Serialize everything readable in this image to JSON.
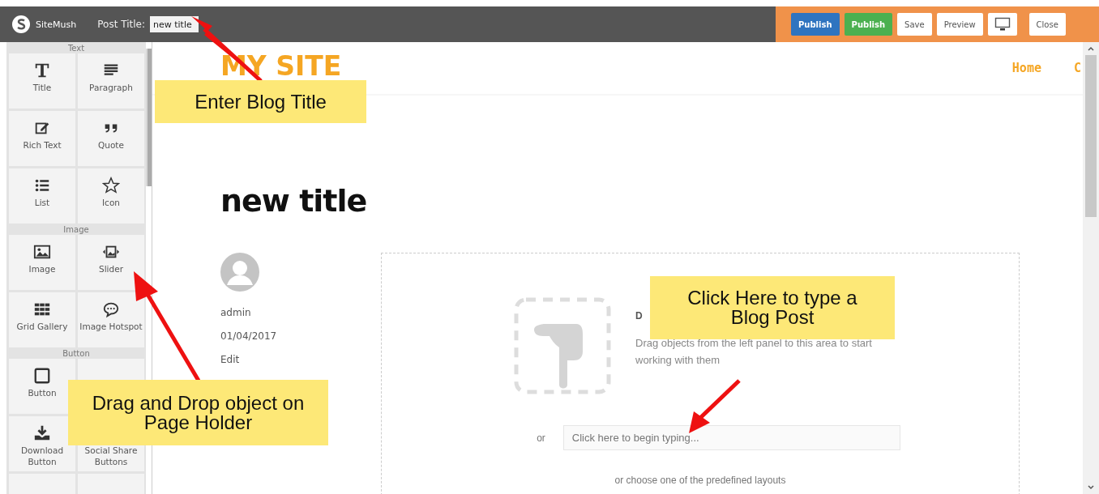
{
  "topbar": {
    "brand": "SiteMush",
    "post_title_label": "Post Title:",
    "post_title_value": "new title",
    "buttons": [
      {
        "kind": "primary",
        "label": "Publish"
      },
      {
        "kind": "success",
        "label": "Publish"
      },
      {
        "kind": "default",
        "label": "Save"
      },
      {
        "kind": "default",
        "label": "Preview"
      },
      {
        "kind": "monitor"
      },
      {
        "kind": "default",
        "label": "Close"
      }
    ]
  },
  "sidebar": {
    "sections": [
      {
        "title": "Text",
        "items": [
          {
            "kind": "title",
            "label": "Title"
          },
          {
            "kind": "paragraph",
            "label": "Paragraph"
          },
          {
            "kind": "richtext",
            "label": "Rich Text"
          },
          {
            "kind": "quote",
            "label": "Quote"
          },
          {
            "kind": "list",
            "label": "List"
          },
          {
            "kind": "star",
            "label": "Icon"
          }
        ]
      },
      {
        "title": "Image",
        "items": [
          {
            "kind": "image",
            "label": "Image"
          },
          {
            "kind": "slider",
            "label": "Slider"
          },
          {
            "kind": "grid",
            "label": "Grid Gallery"
          },
          {
            "kind": "chat",
            "label": "Image Hotspot"
          }
        ]
      },
      {
        "title": "Button",
        "items": [
          {
            "kind": "button",
            "label": "Button"
          },
          {
            "kind": "blank"
          },
          {
            "kind": "download",
            "label": "Download Button"
          },
          {
            "kind": "share",
            "label": "Social Share Buttons"
          },
          {
            "kind": "blank"
          },
          {
            "kind": "blank"
          }
        ]
      }
    ]
  },
  "page": {
    "site_name": "MY SITE",
    "nav": [
      "Home",
      "C"
    ],
    "post_title": "new title",
    "author": "admin",
    "date": "01/04/2017",
    "edit_link": "Edit",
    "dropzone": {
      "heading": "D",
      "text": "Drag objects from the left panel to this area to start working with them",
      "or": "or",
      "placeholder": "Click here to begin typing...",
      "layouts_text": "or choose one of the predefined layouts"
    }
  },
  "callouts": [
    {
      "text": "Enter Blog Title"
    },
    {
      "text": "Click Here to type a Blog Post"
    },
    {
      "text": "Drag and Drop object on Page Holder"
    }
  ]
}
